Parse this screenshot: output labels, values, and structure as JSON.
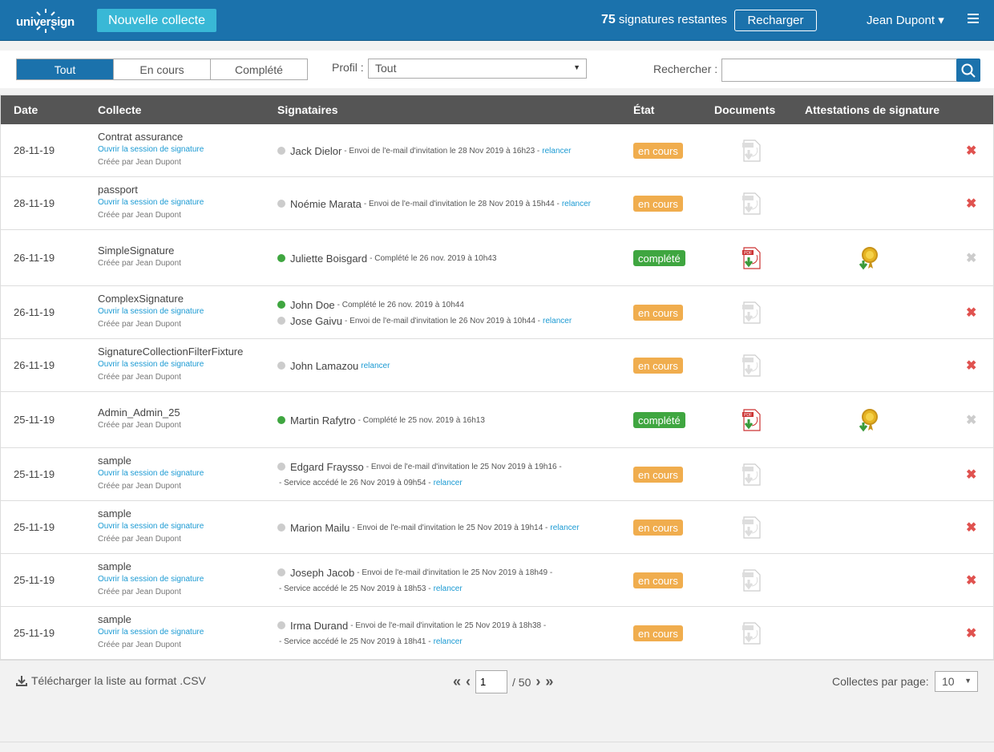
{
  "header": {
    "logo_text": "universign",
    "new_button": "Nouvelle collecte",
    "signatures_count": "75",
    "signatures_text": " signatures restantes",
    "recharge_button": "Recharger",
    "user_name": "Jean Dupont ▾",
    "brand_color": "#1b72ac"
  },
  "filters": {
    "tabs": [
      "Tout",
      "En cours",
      "Complété"
    ],
    "active_tab": "Tout",
    "profil_label": "Profil :",
    "profil_value": "Tout",
    "search_label": "Rechercher :",
    "search_value": ""
  },
  "table": {
    "columns": [
      "Date",
      "Collecte",
      "Signataires",
      "État",
      "Documents",
      "Attestations de signature"
    ],
    "rows": [
      {
        "date": "28-11-19",
        "name": "Contrat assurance",
        "link": "Ouvrir la session de signature",
        "by": "Créée par Jean Dupont",
        "signers": [
          {
            "name": "Jack Dielor",
            "done": false,
            "note": "- Envoi de l'e-mail d'invitation le 28 Nov 2019 à 16h23 -",
            "relancer": "relancer"
          }
        ],
        "status": "en cours",
        "completed": false
      },
      {
        "date": "28-11-19",
        "name": "passport",
        "link": "Ouvrir la session de signature",
        "by": "Créée par Jean Dupont",
        "signers": [
          {
            "name": "Noémie Marata",
            "done": false,
            "note": "- Envoi de l'e-mail d'invitation le 28 Nov 2019 à 15h44 -",
            "relancer": "relancer"
          }
        ],
        "status": "en cours",
        "completed": false
      },
      {
        "date": "26-11-19",
        "name": "SimpleSignature",
        "link": "",
        "by": "Créée par Jean Dupont",
        "signers": [
          {
            "name": "Juliette Boisgard",
            "done": true,
            "note": "- Complété le 26 nov. 2019 à 10h43",
            "relancer": ""
          }
        ],
        "status": "complété",
        "completed": true
      },
      {
        "date": "26-11-19",
        "name": "ComplexSignature",
        "link": "Ouvrir la session de signature",
        "by": "Créée par Jean Dupont",
        "signers": [
          {
            "name": "John Doe",
            "done": true,
            "note": "- Complété le 26 nov. 2019 à 10h44",
            "relancer": ""
          },
          {
            "name": "Jose Gaivu",
            "done": false,
            "note": "- Envoi de l'e-mail d'invitation le 26 Nov 2019 à 10h44 -",
            "relancer": "relancer"
          }
        ],
        "status": "en cours",
        "completed": false
      },
      {
        "date": "26-11-19",
        "name": "SignatureCollectionFilterFixture",
        "link": "Ouvrir la session de signature",
        "by": "Créée par Jean Dupont",
        "signers": [
          {
            "name": "John Lamazou",
            "done": false,
            "note": "",
            "relancer": "relancer"
          }
        ],
        "status": "en cours",
        "completed": false
      },
      {
        "date": "25-11-19",
        "name": "Admin_Admin_25",
        "link": "",
        "by": "Créée par Jean Dupont",
        "signers": [
          {
            "name": "Martin Rafytro",
            "done": true,
            "note": "- Complété le 25 nov. 2019 à 16h13",
            "relancer": ""
          }
        ],
        "status": "complété",
        "completed": true
      },
      {
        "date": "25-11-19",
        "name": "sample",
        "link": "Ouvrir la session de signature",
        "by": "Créée par Jean Dupont",
        "signers": [
          {
            "name": "Edgard Fraysso",
            "done": false,
            "note": "- Envoi de l'e-mail d'invitation le 25 Nov 2019 à 19h16 -",
            "sub": "- Service accédé le 26 Nov 2019 à 09h54 -",
            "relancer": "relancer"
          }
        ],
        "status": "en cours",
        "completed": false
      },
      {
        "date": "25-11-19",
        "name": "sample",
        "link": "Ouvrir la session de signature",
        "by": "Créée par Jean Dupont",
        "signers": [
          {
            "name": "Marion Mailu",
            "done": false,
            "note": "- Envoi de l'e-mail d'invitation le 25 Nov 2019 à 19h14 -",
            "relancer": "relancer"
          }
        ],
        "status": "en cours",
        "completed": false
      },
      {
        "date": "25-11-19",
        "name": "sample",
        "link": "Ouvrir la session de signature",
        "by": "Créée par Jean Dupont",
        "signers": [
          {
            "name": "Joseph Jacob",
            "done": false,
            "note": "- Envoi de l'e-mail d'invitation le 25 Nov 2019 à 18h49 -",
            "sub": "- Service accédé le 25 Nov 2019 à 18h53 -",
            "relancer": "relancer"
          }
        ],
        "status": "en cours",
        "completed": false
      },
      {
        "date": "25-11-19",
        "name": "sample",
        "link": "Ouvrir la session de signature",
        "by": "Créée par Jean Dupont",
        "signers": [
          {
            "name": "Irma Durand",
            "done": false,
            "note": "- Envoi de l'e-mail d'invitation le 25 Nov 2019 à 18h38 -",
            "sub": "- Service accédé le 25 Nov 2019 à 18h41 -",
            "relancer": "relancer"
          }
        ],
        "status": "en cours",
        "completed": false
      }
    ]
  },
  "footer": {
    "csv_link": "Télécharger la liste au format .CSV",
    "page_current": "1",
    "page_total": "/ 50",
    "perpage_label": "Collectes par page:",
    "perpage_value": "10"
  },
  "icons": {
    "download": "download-icon",
    "search": "search-icon",
    "menu": "hamburger-menu-icon",
    "pdf": "pdf-download-icon",
    "certificate": "certificate-award-icon",
    "delete": "delete-x-icon"
  }
}
